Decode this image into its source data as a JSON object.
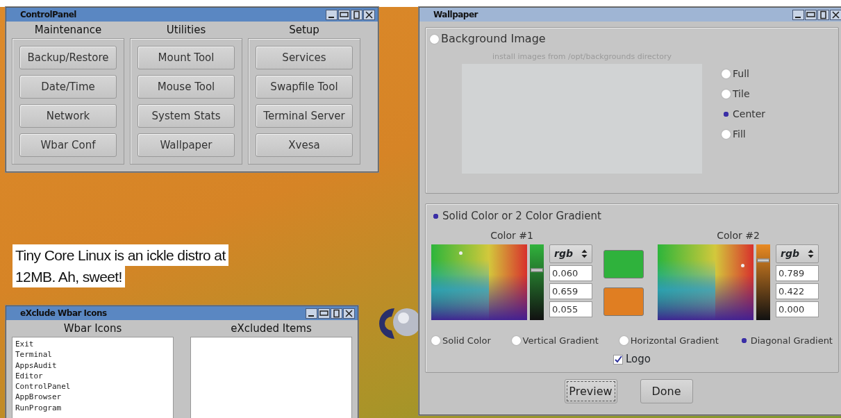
{
  "desktop": {
    "caption": [
      "Tiny Core Linux is an ickle distro at",
      "12MB. Ah, sweet!"
    ]
  },
  "control_panel": {
    "title": "ControlPanel",
    "active": true,
    "groups": [
      {
        "heading": "Maintenance",
        "buttons": [
          "Backup/Restore",
          "Date/Time",
          "Network",
          "Wbar Conf"
        ]
      },
      {
        "heading": "Utilities",
        "buttons": [
          "Mount Tool",
          "Mouse Tool",
          "System Stats",
          "Wallpaper"
        ]
      },
      {
        "heading": "Setup",
        "buttons": [
          "Services",
          "Swapfile Tool",
          "Terminal Server",
          "Xvesa"
        ]
      }
    ]
  },
  "exclude_window": {
    "title": "eXclude Wbar Icons",
    "active": true,
    "wbar_icons": {
      "heading": "Wbar Icons",
      "items": [
        "Exit",
        "Terminal",
        "AppsAudit",
        "Editor",
        "ControlPanel",
        "AppBrowser",
        "RunProgram"
      ]
    },
    "excluded_items": {
      "heading": "eXcluded Items"
    }
  },
  "wallpaper": {
    "title": "Wallpaper",
    "active": false,
    "background_image": {
      "label": "Background Image",
      "selected": false,
      "hint": "install images from /opt/backgrounds directory",
      "placements": [
        {
          "label": "Full",
          "selected": false
        },
        {
          "label": "Tile",
          "selected": false
        },
        {
          "label": "Center",
          "selected": true
        },
        {
          "label": "Fill",
          "selected": false
        }
      ]
    },
    "solid": {
      "label": "Solid Color or 2 Color Gradient",
      "selected": true,
      "colors": [
        {
          "label": "Color #1",
          "mode": "rgb",
          "level": 0.659,
          "values": [
            "0.060",
            "0.659",
            "0.055"
          ]
        },
        {
          "label": "Color #2",
          "mode": "rgb",
          "level": 0.789,
          "values": [
            "0.789",
            "0.422",
            "0.000"
          ]
        }
      ],
      "swatches": [
        {
          "color": "#2fb23c"
        },
        {
          "color": "#e07e22"
        }
      ],
      "gradients": [
        {
          "label": "Solid Color",
          "selected": false
        },
        {
          "label": "Vertical Gradient",
          "selected": false
        },
        {
          "label": "Horizontal Gradient",
          "selected": false
        },
        {
          "label": "Diagonal Gradient",
          "selected": true
        }
      ],
      "logo": {
        "label": "Logo",
        "checked": true
      }
    },
    "buttons": [
      "Preview",
      "Done"
    ]
  }
}
